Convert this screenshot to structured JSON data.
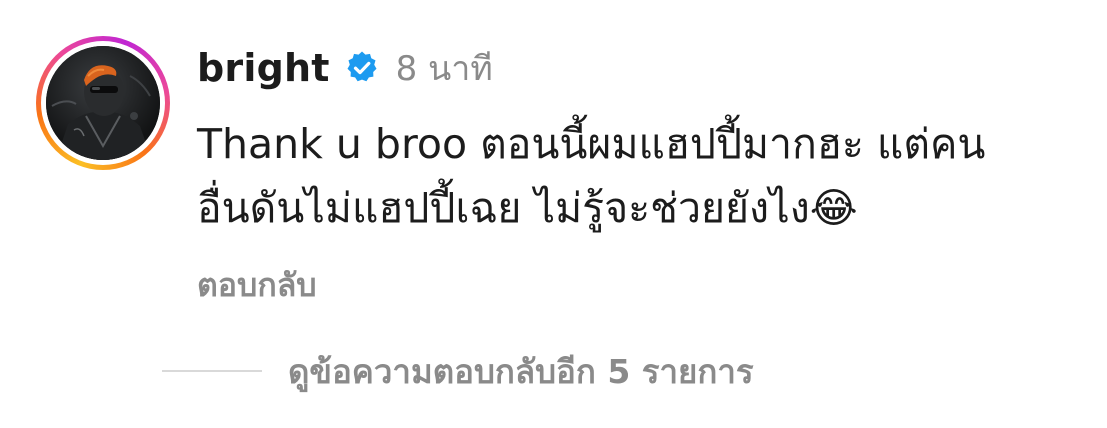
{
  "comment": {
    "username": "bright",
    "verified": true,
    "time": "8 นาที",
    "text_lines": [
      "Thank u broo ตอนนี้ผมแฮปปี้มากฮะ แต่คน",
      "อื่นดันไม่แฮปปี้เฉย ไม่รู้จะช่วยยังไง😂"
    ],
    "reply_label": "ตอบกลับ",
    "view_replies_label": "ดูข้อความตอบกลับอีก 5 รายการ"
  },
  "colors": {
    "text": "#1c1c1c",
    "muted": "#8a8a8a",
    "verified_blue": "#1d9bf0",
    "divider": "#d9d9d9",
    "story_ring": [
      "#fbbf24",
      "#f97316",
      "#ec4899",
      "#c026d3"
    ]
  },
  "icons": {
    "verified": "verified-badge-icon"
  }
}
